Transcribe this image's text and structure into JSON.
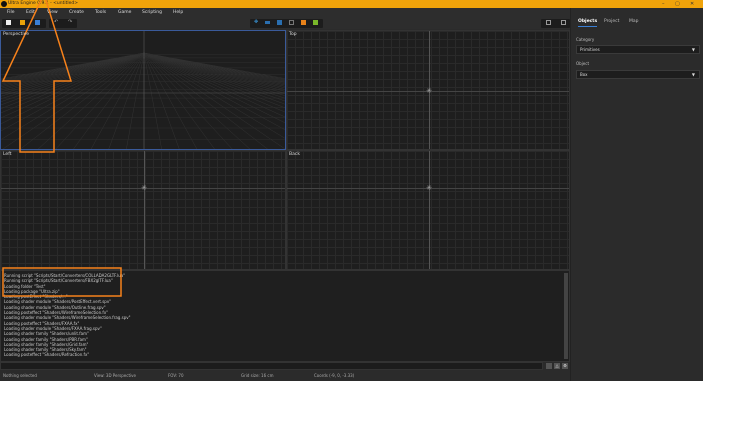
{
  "window": {
    "title": "Ultra Engine 0.9.1 - <untitled>",
    "controls": [
      "–",
      "▢",
      "✕"
    ]
  },
  "menu": [
    "File",
    "Edit",
    "View",
    "Create",
    "Tools",
    "Game",
    "Scripting",
    "Help"
  ],
  "toolbar": {
    "left_icons": [
      "new-file-icon",
      "open-folder-icon",
      "save-icon",
      "undo-icon",
      "redo-icon"
    ],
    "center_icons": [
      "move-icon",
      "rotate-icon",
      "scale-icon",
      "box-select-icon",
      "cube-icon",
      "play-icon"
    ],
    "right_icons": [
      "single-view-icon",
      "quad-view-icon"
    ]
  },
  "viewports": {
    "perspective": "Perspective",
    "top": "Top",
    "left": "Left",
    "back": "Back"
  },
  "console": {
    "lines": [
      "Running script \"Scripts/Start/Converters/COLLADA2GLTF.lua\"",
      "Running script \"Scripts/Start/Converters/FBX2glTF.lua\"",
      "Loading folder \"Test\"",
      "Loading package \"Ultra.zip\"",
      "Loading postEffect \"Shaders/...\"",
      "Loading shader module \"Shaders/PostEffect.vert.spv\"",
      "Loading shader module \"Shaders/Outline.frag.spv\"",
      "Loading posteffect \"Shaders/WireframeSelection.fx\"",
      "Loading shader module \"Shaders/WireframeSelection.frag.spv\"",
      "Loading posteffect \"Shaders/FXAA.fx\"",
      "Loading shader module \"Shaders/FXAA.frag.spv\"",
      "Loading shader family \"Shaders/unlit.fam\"",
      "Loading shader family \"Shaders/PBR.fam\"",
      "Loading shader family \"Shaders/Grid.fam\"",
      "Loading shader family \"Shaders/Sky.fam\"",
      "Loading posteffect \"Shaders/Refraction.fx\""
    ]
  },
  "status": {
    "selection": "Nothing selected",
    "view": "View: 3D Perspective",
    "fov": "FOV: 70",
    "grid": "Grid size: 16 cm",
    "coords": "Coords (-9, 0, -3.33)"
  },
  "panel": {
    "tabs": [
      "Objects",
      "Project",
      "Map"
    ],
    "active_tab": "Objects",
    "category_label": "Category",
    "category_value": "Primitives",
    "object_label": "Object",
    "object_value": "Box"
  },
  "colors": {
    "accent": "#f0a30a",
    "annotation": "#f7821b",
    "selection": "#3a7fd5"
  }
}
